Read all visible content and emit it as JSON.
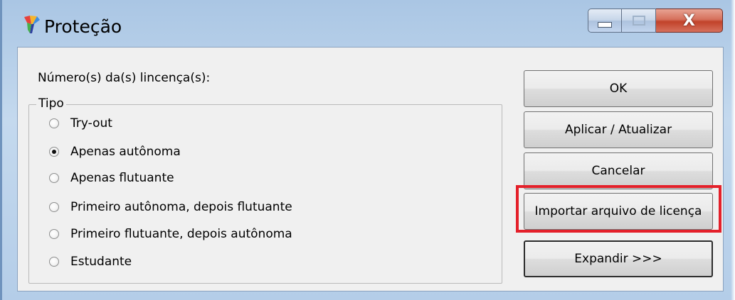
{
  "window": {
    "title": "Proteção",
    "close_symbol": "X"
  },
  "colors": {
    "highlight": "#e4202a",
    "frame": "#b4cde8",
    "client_bg": "#f0f0f0"
  },
  "icons": [
    "app-icon",
    "minimize-icon",
    "maximize-icon",
    "close-icon"
  ],
  "form": {
    "license_label": "Número(s) da(s) lincença(s):",
    "type_group_title": "Tipo",
    "options": [
      {
        "label": "Try-out",
        "checked": false
      },
      {
        "label": "Apenas autônoma",
        "checked": true
      },
      {
        "label": "Apenas flutuante",
        "checked": false
      },
      {
        "label": "Primeiro autônoma, depois flutuante",
        "checked": false
      },
      {
        "label": "Primeiro flutuante, depois autônoma",
        "checked": false
      },
      {
        "label": "Estudante",
        "checked": false
      }
    ]
  },
  "buttons": {
    "ok": "OK",
    "apply": "Aplicar / Atualizar",
    "cancel": "Cancelar",
    "import": "Importar arquivo de licença",
    "expand": "Expandir >>>"
  }
}
